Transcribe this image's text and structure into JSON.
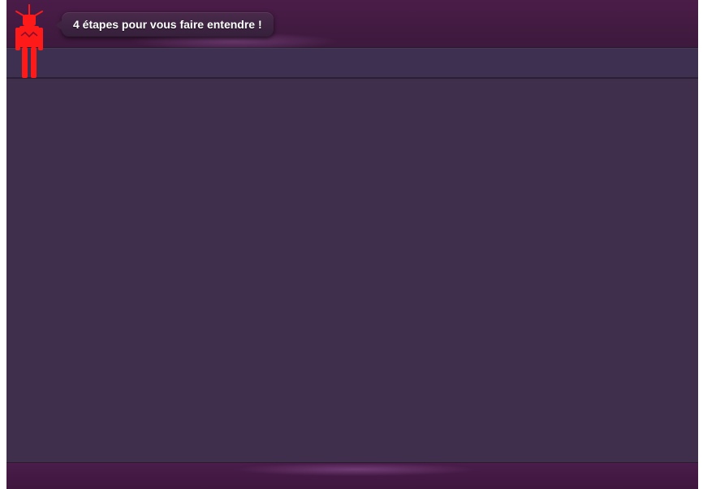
{
  "header": {
    "speech_bubble_text": "4 étapes pour vous faire entendre !",
    "mascot_icon": "red-robot-mascot-icon"
  },
  "colors": {
    "top_bar": "#4a1c48",
    "panel": "#3f2f4d",
    "subbar": "#3d3050",
    "bottom_bar": "#4a1d4a",
    "mascot": "#ff1a1a",
    "bubble_text": "#ffffff"
  }
}
